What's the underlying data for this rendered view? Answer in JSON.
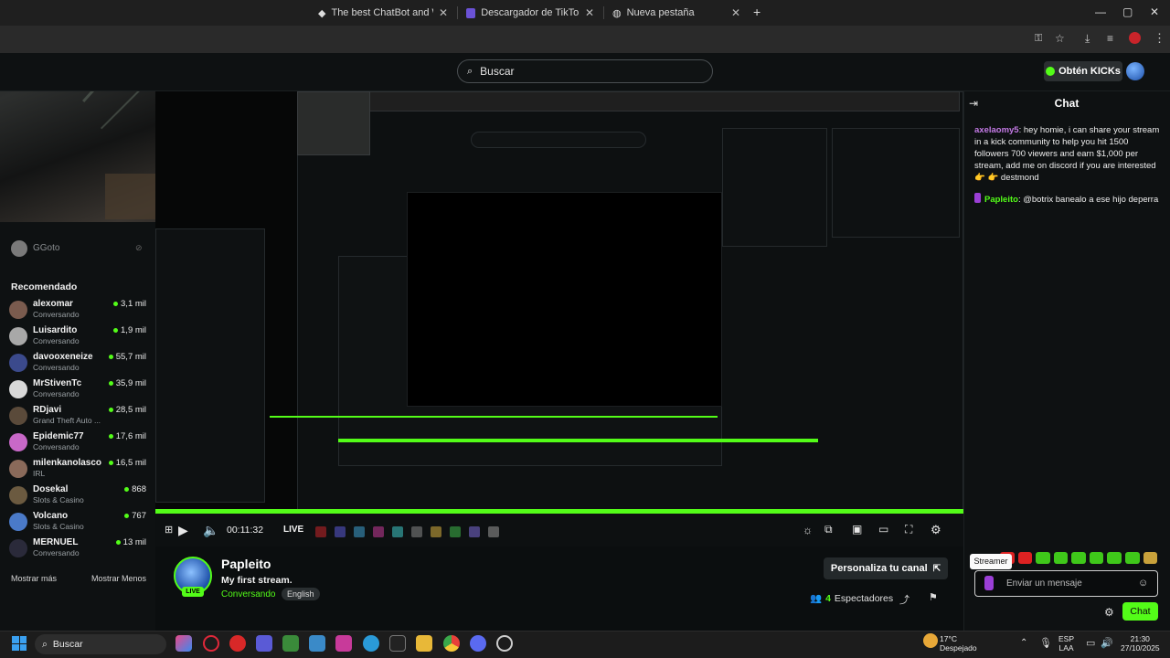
{
  "browser": {
    "tabs": [
      {
        "title": "The best ChatBot and Widgets"
      },
      {
        "title": "Descargador de TikTok | Descarg"
      },
      {
        "title": "Nueva pestaña"
      }
    ],
    "new_tab": "+",
    "min": "—",
    "max": "▢",
    "close": "✕"
  },
  "site": {
    "search_placeholder": "Buscar",
    "kicks_button": "Obtén KICKs"
  },
  "sidebar": {
    "offline_item": "GGoto",
    "recommended_title": "Recomendado",
    "items": [
      {
        "name": "alexomar",
        "sub": "Conversando",
        "count": "3,1 mil",
        "color": "#7a5b4e"
      },
      {
        "name": "Luisardito",
        "sub": "Conversando",
        "count": "1,9 mil",
        "color": "#a8a8a8"
      },
      {
        "name": "davooxeneize",
        "sub": "Conversando",
        "count": "55,7 mil",
        "color": "#3b4a8c"
      },
      {
        "name": "MrStivenTc",
        "sub": "Conversando",
        "count": "35,9 mil",
        "color": "#d8d8d8"
      },
      {
        "name": "RDjavi",
        "sub": "Grand Theft Auto ...",
        "count": "28,5 mil",
        "color": "#5a4a3a"
      },
      {
        "name": "Epidemic77",
        "sub": "Conversando",
        "count": "17,6 mil",
        "color": "#c868c8"
      },
      {
        "name": "milenkanolasco",
        "sub": "IRL",
        "count": "16,5 mil",
        "color": "#8a6a5a"
      },
      {
        "name": "Dosekal",
        "sub": "Slots & Casino",
        "count": "868",
        "color": "#6b5a40"
      },
      {
        "name": "Volcano",
        "sub": "Slots & Casino",
        "count": "767",
        "color": "#4a7ac8"
      },
      {
        "name": "MERNUEL",
        "sub": "Conversando",
        "count": "13 mil",
        "color": "#2a2a3a"
      }
    ],
    "show_more": "Mostrar más",
    "show_less": "Mostrar Menos"
  },
  "player": {
    "time": "00:11:32",
    "live": "LIVE",
    "progress_fraction": 1.0
  },
  "channel": {
    "name": "Papleito",
    "live_badge": "LIVE",
    "stream_title": "My first stream.",
    "category": "Conversando",
    "language": "English",
    "customize_button": "Personaliza tu canal",
    "viewer_count": "4",
    "viewer_label": "Espectadores"
  },
  "chat": {
    "title": "Chat",
    "messages": [
      {
        "user": "axelaomy5",
        "user_color": "#c47ae6",
        "text": "hey homie, i can share your stream in a kick community to help you hit 1500 followers 700 viewers and earn $1,000 per stream, add me on discord if you are interested 👉 👉 destmond"
      },
      {
        "user": "Papleito",
        "user_color": "#53fc18",
        "text": "@botrix banealo a ese hijo deperra"
      }
    ],
    "streamer_tooltip": "Streamer",
    "input_placeholder": "Enviar un mensaje",
    "send_button": "Chat"
  },
  "taskbar": {
    "search": "Buscar",
    "weather_temp": "17°C",
    "weather_desc": "Despejado",
    "lang_top": "ESP",
    "lang_bottom": "LAA",
    "time": "21:30",
    "date": "27/10/2025"
  }
}
